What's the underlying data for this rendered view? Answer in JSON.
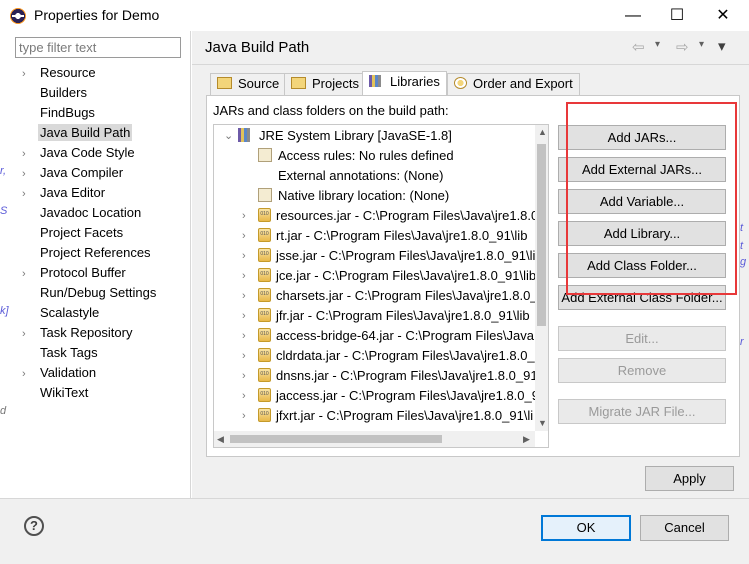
{
  "window": {
    "title": "Properties for Demo",
    "minimize": "—",
    "maximize": "☐",
    "close": "✕"
  },
  "filter": {
    "placeholder": "type filter text"
  },
  "nav": {
    "items": [
      {
        "label": "Resource",
        "expandable": true
      },
      {
        "label": "Builders",
        "expandable": false
      },
      {
        "label": "FindBugs",
        "expandable": false
      },
      {
        "label": "Java Build Path",
        "expandable": false,
        "selected": true
      },
      {
        "label": "Java Code Style",
        "expandable": true
      },
      {
        "label": "Java Compiler",
        "expandable": true
      },
      {
        "label": "Java Editor",
        "expandable": true
      },
      {
        "label": "Javadoc Location",
        "expandable": false
      },
      {
        "label": "Project Facets",
        "expandable": false
      },
      {
        "label": "Project References",
        "expandable": false
      },
      {
        "label": "Protocol Buffer",
        "expandable": true
      },
      {
        "label": "Run/Debug Settings",
        "expandable": false
      },
      {
        "label": "Scalastyle",
        "expandable": false
      },
      {
        "label": "Task Repository",
        "expandable": true
      },
      {
        "label": "Task Tags",
        "expandable": false
      },
      {
        "label": "Validation",
        "expandable": true
      },
      {
        "label": "WikiText",
        "expandable": false
      }
    ]
  },
  "page": {
    "title": "Java Build Path",
    "back_icon": "⇦",
    "forward_icon": "⇨",
    "menu_icon": "▾"
  },
  "tabs": [
    {
      "label": "Source",
      "active": false
    },
    {
      "label": "Projects",
      "active": false
    },
    {
      "label": "Libraries",
      "active": true
    },
    {
      "label": "Order and Export",
      "active": false
    }
  ],
  "libraries": {
    "label": "JARs and class folders on the build path:",
    "root": "JRE System Library [JavaSE-1.8]",
    "attributes": [
      "Access rules: No rules defined",
      "External annotations: (None)",
      "Native library location: (None)"
    ],
    "jars": [
      "resources.jar - C:\\Program Files\\Java\\jre1.8.0",
      "rt.jar - C:\\Program Files\\Java\\jre1.8.0_91\\lib",
      "jsse.jar - C:\\Program Files\\Java\\jre1.8.0_91\\lib",
      "jce.jar - C:\\Program Files\\Java\\jre1.8.0_91\\lib",
      "charsets.jar - C:\\Program Files\\Java\\jre1.8.0_91",
      "jfr.jar - C:\\Program Files\\Java\\jre1.8.0_91\\lib",
      "access-bridge-64.jar - C:\\Program Files\\Java",
      "cldrdata.jar - C:\\Program Files\\Java\\jre1.8.0_91",
      "dnsns.jar - C:\\Program Files\\Java\\jre1.8.0_91",
      "jaccess.jar - C:\\Program Files\\Java\\jre1.8.0_91",
      "jfxrt.jar - C:\\Program Files\\Java\\jre1.8.0_91\\li"
    ]
  },
  "buttons": {
    "add_jars": "Add JARs...",
    "add_external_jars": "Add External JARs...",
    "add_variable": "Add Variable...",
    "add_library": "Add Library...",
    "add_class_folder": "Add Class Folder...",
    "add_external_class_folder": "Add External Class Folder...",
    "edit": "Edit...",
    "remove": "Remove",
    "migrate_jar": "Migrate JAR File..."
  },
  "footer": {
    "apply": "Apply",
    "ok": "OK",
    "cancel": "Cancel",
    "help": "?"
  },
  "colors": {
    "highlight": "#e8383a",
    "ok_border": "#0078d7",
    "selection": "#d9d9d9"
  }
}
